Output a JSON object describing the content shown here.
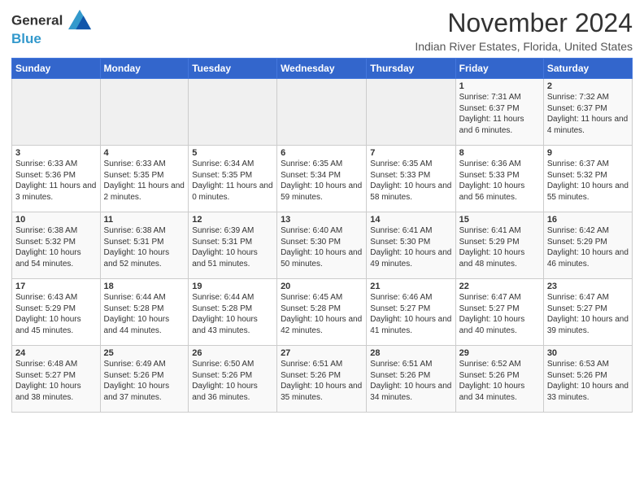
{
  "logo": {
    "line1": "General",
    "line2": "Blue"
  },
  "title": "November 2024",
  "subtitle": "Indian River Estates, Florida, United States",
  "days_header": [
    "Sunday",
    "Monday",
    "Tuesday",
    "Wednesday",
    "Thursday",
    "Friday",
    "Saturday"
  ],
  "weeks": [
    [
      {
        "day": "",
        "info": ""
      },
      {
        "day": "",
        "info": ""
      },
      {
        "day": "",
        "info": ""
      },
      {
        "day": "",
        "info": ""
      },
      {
        "day": "",
        "info": ""
      },
      {
        "day": "1",
        "info": "Sunrise: 7:31 AM\nSunset: 6:37 PM\nDaylight: 11 hours and 6 minutes."
      },
      {
        "day": "2",
        "info": "Sunrise: 7:32 AM\nSunset: 6:37 PM\nDaylight: 11 hours and 4 minutes."
      }
    ],
    [
      {
        "day": "3",
        "info": "Sunrise: 6:33 AM\nSunset: 5:36 PM\nDaylight: 11 hours and 3 minutes."
      },
      {
        "day": "4",
        "info": "Sunrise: 6:33 AM\nSunset: 5:35 PM\nDaylight: 11 hours and 2 minutes."
      },
      {
        "day": "5",
        "info": "Sunrise: 6:34 AM\nSunset: 5:35 PM\nDaylight: 11 hours and 0 minutes."
      },
      {
        "day": "6",
        "info": "Sunrise: 6:35 AM\nSunset: 5:34 PM\nDaylight: 10 hours and 59 minutes."
      },
      {
        "day": "7",
        "info": "Sunrise: 6:35 AM\nSunset: 5:33 PM\nDaylight: 10 hours and 58 minutes."
      },
      {
        "day": "8",
        "info": "Sunrise: 6:36 AM\nSunset: 5:33 PM\nDaylight: 10 hours and 56 minutes."
      },
      {
        "day": "9",
        "info": "Sunrise: 6:37 AM\nSunset: 5:32 PM\nDaylight: 10 hours and 55 minutes."
      }
    ],
    [
      {
        "day": "10",
        "info": "Sunrise: 6:38 AM\nSunset: 5:32 PM\nDaylight: 10 hours and 54 minutes."
      },
      {
        "day": "11",
        "info": "Sunrise: 6:38 AM\nSunset: 5:31 PM\nDaylight: 10 hours and 52 minutes."
      },
      {
        "day": "12",
        "info": "Sunrise: 6:39 AM\nSunset: 5:31 PM\nDaylight: 10 hours and 51 minutes."
      },
      {
        "day": "13",
        "info": "Sunrise: 6:40 AM\nSunset: 5:30 PM\nDaylight: 10 hours and 50 minutes."
      },
      {
        "day": "14",
        "info": "Sunrise: 6:41 AM\nSunset: 5:30 PM\nDaylight: 10 hours and 49 minutes."
      },
      {
        "day": "15",
        "info": "Sunrise: 6:41 AM\nSunset: 5:29 PM\nDaylight: 10 hours and 48 minutes."
      },
      {
        "day": "16",
        "info": "Sunrise: 6:42 AM\nSunset: 5:29 PM\nDaylight: 10 hours and 46 minutes."
      }
    ],
    [
      {
        "day": "17",
        "info": "Sunrise: 6:43 AM\nSunset: 5:29 PM\nDaylight: 10 hours and 45 minutes."
      },
      {
        "day": "18",
        "info": "Sunrise: 6:44 AM\nSunset: 5:28 PM\nDaylight: 10 hours and 44 minutes."
      },
      {
        "day": "19",
        "info": "Sunrise: 6:44 AM\nSunset: 5:28 PM\nDaylight: 10 hours and 43 minutes."
      },
      {
        "day": "20",
        "info": "Sunrise: 6:45 AM\nSunset: 5:28 PM\nDaylight: 10 hours and 42 minutes."
      },
      {
        "day": "21",
        "info": "Sunrise: 6:46 AM\nSunset: 5:27 PM\nDaylight: 10 hours and 41 minutes."
      },
      {
        "day": "22",
        "info": "Sunrise: 6:47 AM\nSunset: 5:27 PM\nDaylight: 10 hours and 40 minutes."
      },
      {
        "day": "23",
        "info": "Sunrise: 6:47 AM\nSunset: 5:27 PM\nDaylight: 10 hours and 39 minutes."
      }
    ],
    [
      {
        "day": "24",
        "info": "Sunrise: 6:48 AM\nSunset: 5:27 PM\nDaylight: 10 hours and 38 minutes."
      },
      {
        "day": "25",
        "info": "Sunrise: 6:49 AM\nSunset: 5:26 PM\nDaylight: 10 hours and 37 minutes."
      },
      {
        "day": "26",
        "info": "Sunrise: 6:50 AM\nSunset: 5:26 PM\nDaylight: 10 hours and 36 minutes."
      },
      {
        "day": "27",
        "info": "Sunrise: 6:51 AM\nSunset: 5:26 PM\nDaylight: 10 hours and 35 minutes."
      },
      {
        "day": "28",
        "info": "Sunrise: 6:51 AM\nSunset: 5:26 PM\nDaylight: 10 hours and 34 minutes."
      },
      {
        "day": "29",
        "info": "Sunrise: 6:52 AM\nSunset: 5:26 PM\nDaylight: 10 hours and 34 minutes."
      },
      {
        "day": "30",
        "info": "Sunrise: 6:53 AM\nSunset: 5:26 PM\nDaylight: 10 hours and 33 minutes."
      }
    ]
  ]
}
